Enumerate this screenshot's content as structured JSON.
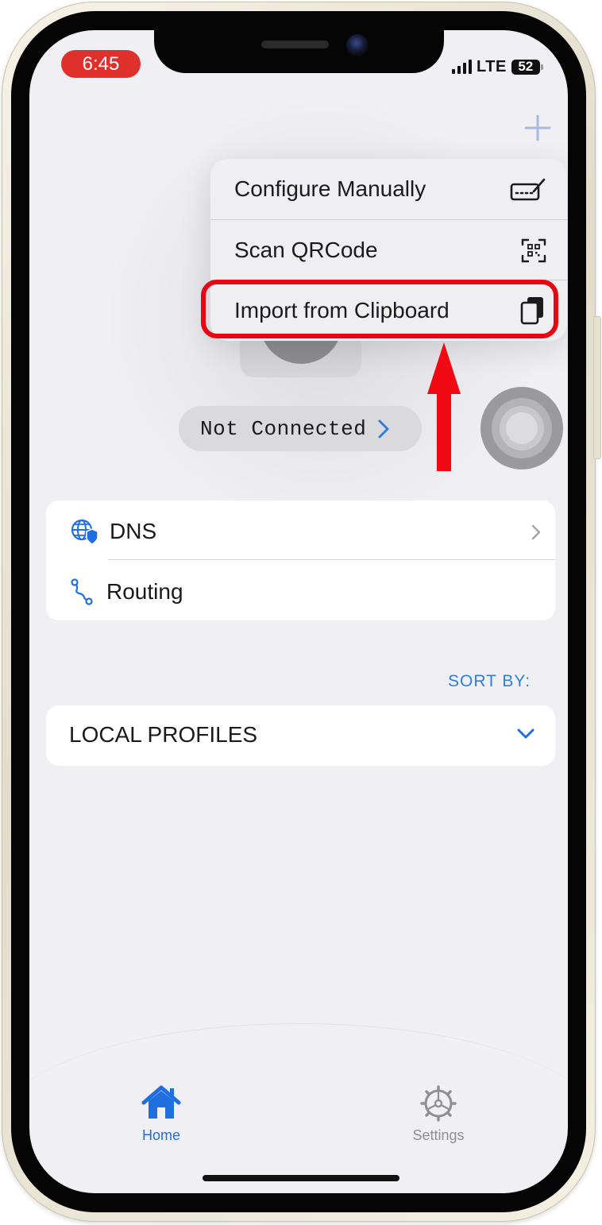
{
  "status_bar": {
    "time": "6:45",
    "network": "LTE",
    "battery": "52"
  },
  "toolbar": {
    "add_icon": "plus-icon"
  },
  "menu": {
    "items": [
      {
        "label": "Configure Manually",
        "icon": "keyboard-pencil-icon"
      },
      {
        "label": "Scan QRCode",
        "icon": "qrcode-viewfinder-icon"
      },
      {
        "label": "Import from Clipboard",
        "icon": "clipboard-icon"
      }
    ],
    "highlighted_item": "Import from Clipboard"
  },
  "annotation": {
    "color": "#e80613"
  },
  "connection": {
    "status": "Not Connected"
  },
  "settings_list": [
    {
      "label": "DNS",
      "icon": "globe-shield-icon"
    },
    {
      "label": "Routing",
      "icon": "route-icon"
    }
  ],
  "profiles": {
    "sort_label": "SORT BY:",
    "section_label": "LOCAL PROFILES"
  },
  "tab_bar": {
    "tabs": [
      {
        "label": "Home",
        "icon": "house-icon",
        "active": true
      },
      {
        "label": "Settings",
        "icon": "gear-icon",
        "active": false
      }
    ]
  },
  "colors": {
    "accent": "#1f6fe0",
    "highlight": "#e80613",
    "time_pill": "#e0302c"
  }
}
